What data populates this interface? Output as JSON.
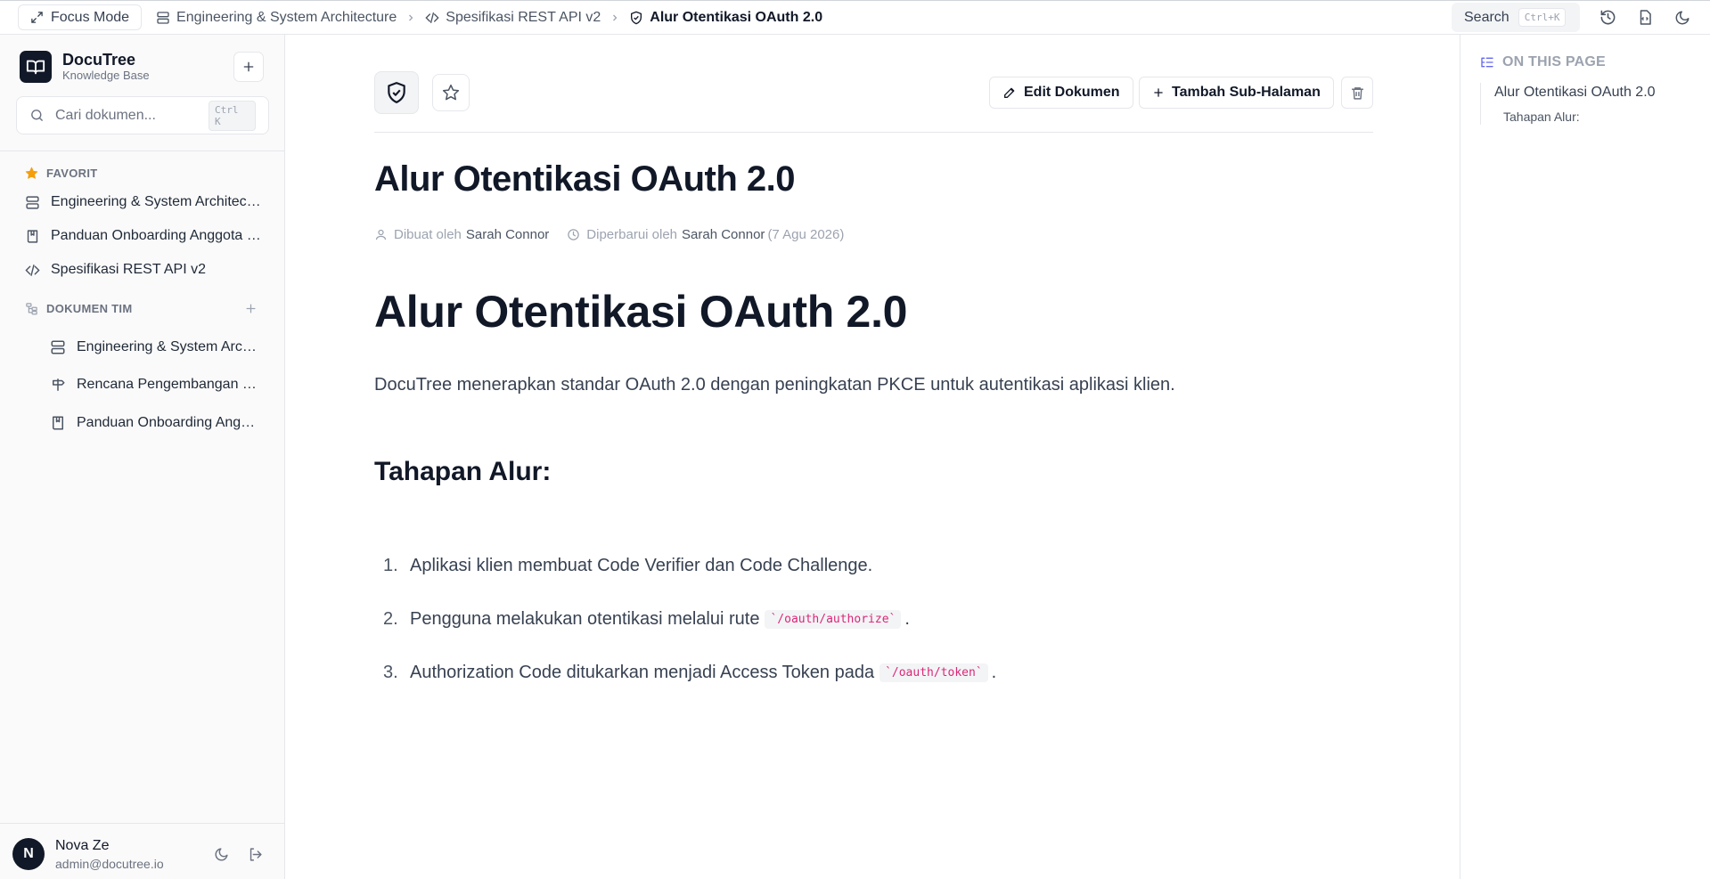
{
  "topbar": {
    "focus_label": "Focus Mode",
    "breadcrumbs": [
      {
        "label": "Engineering & System Architecture",
        "icon": "server-icon"
      },
      {
        "label": "Spesifikasi REST API v2",
        "icon": "code-icon"
      },
      {
        "label": "Alur Otentikasi OAuth 2.0",
        "icon": "shield-check-icon"
      }
    ],
    "search_label": "Search",
    "search_shortcut": "Ctrl+K"
  },
  "sidebar": {
    "brand_name": "DocuTree",
    "brand_sub": "Knowledge Base",
    "search_placeholder": "Cari dokumen...",
    "search_shortcut": "Ctrl K",
    "favorites_title": "FAVORIT",
    "favorites": [
      {
        "label": "Engineering & System Architecture",
        "icon": "server-icon"
      },
      {
        "label": "Panduan Onboarding Anggota Baru",
        "icon": "book-icon"
      },
      {
        "label": "Spesifikasi REST API v2",
        "icon": "code-icon"
      }
    ],
    "team_title": "DOKUMEN TIM",
    "team_docs": [
      {
        "label": "Engineering & System Architecture",
        "icon": "server-icon"
      },
      {
        "label": "Rencana Pengembangan Produk",
        "icon": "signpost-icon"
      },
      {
        "label": "Panduan Onboarding Anggota Baru",
        "icon": "book-icon"
      }
    ],
    "user": {
      "initial": "N",
      "name": "Nova Ze",
      "email": "admin@docutree.io"
    }
  },
  "main": {
    "edit_label": "Edit Dokumen",
    "add_sub_label": "Tambah Sub-Halaman",
    "title": "Alur Otentikasi OAuth 2.0",
    "meta": {
      "created_prefix": "Dibuat oleh",
      "created_by": "Sarah Connor",
      "updated_prefix": "Diperbarui oleh",
      "updated_by": "Sarah Connor",
      "updated_date": "(7 Agu 2026)"
    },
    "heading1": "Alur Otentikasi OAuth 2.0",
    "paragraph": "DocuTree menerapkan standar OAuth 2.0 dengan peningkatan PKCE untuk autentikasi aplikasi klien.",
    "heading2": "Tahapan Alur:",
    "steps": [
      {
        "num": "1.",
        "text": "Aplikasi klien membuat Code Verifier dan Code Challenge.",
        "code": "",
        "after": ""
      },
      {
        "num": "2.",
        "text": "Pengguna melakukan otentikasi melalui rute",
        "code": "`/oauth/authorize`",
        "after": "."
      },
      {
        "num": "3.",
        "text": "Authorization Code ditukarkan menjadi Access Token pada",
        "code": "`/oauth/token`",
        "after": "."
      }
    ]
  },
  "toc": {
    "title": "ON THIS PAGE",
    "items": [
      "Alur Otentikasi OAuth 2.0",
      "Tahapan Alur:"
    ]
  },
  "colors": {
    "accent_star": "#f59e0b",
    "toc_icon": "#6366f1",
    "code_text": "#db2777"
  }
}
